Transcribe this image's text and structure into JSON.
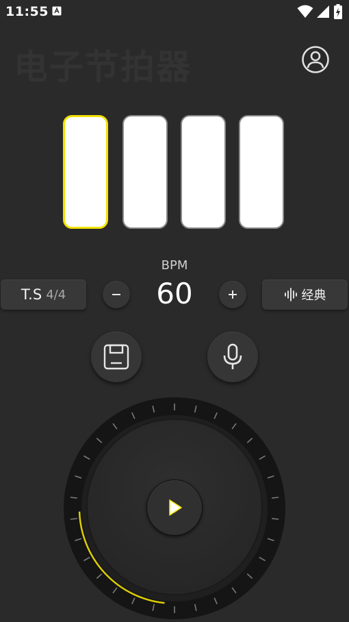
{
  "status_bar": {
    "time": "11:55",
    "icons": [
      "app-notification-icon",
      "wifi-icon",
      "signal-icon",
      "battery-charging-icon"
    ]
  },
  "header": {
    "title": "电子节拍器",
    "profile_icon": "account-circle-icon"
  },
  "beats": {
    "count": 4,
    "active_index": 0,
    "colors": {
      "active_border": "#f2e200",
      "inactive_border": "#8a8a8a",
      "fill": "#ffffff"
    }
  },
  "tempo": {
    "label": "BPM",
    "value": "60",
    "decrement_label": "−",
    "increment_label": "+"
  },
  "time_signature": {
    "label": "T.S",
    "value": "4/4"
  },
  "sound": {
    "icon": "waveform-icon",
    "label": "经典"
  },
  "actions": {
    "save_icon": "save-icon",
    "mic_icon": "microphone-icon"
  },
  "dial": {
    "play_icon": "play-icon",
    "accent_color": "#f2e200"
  },
  "colors": {
    "background": "#2a2a2a",
    "accent": "#f2e200"
  }
}
